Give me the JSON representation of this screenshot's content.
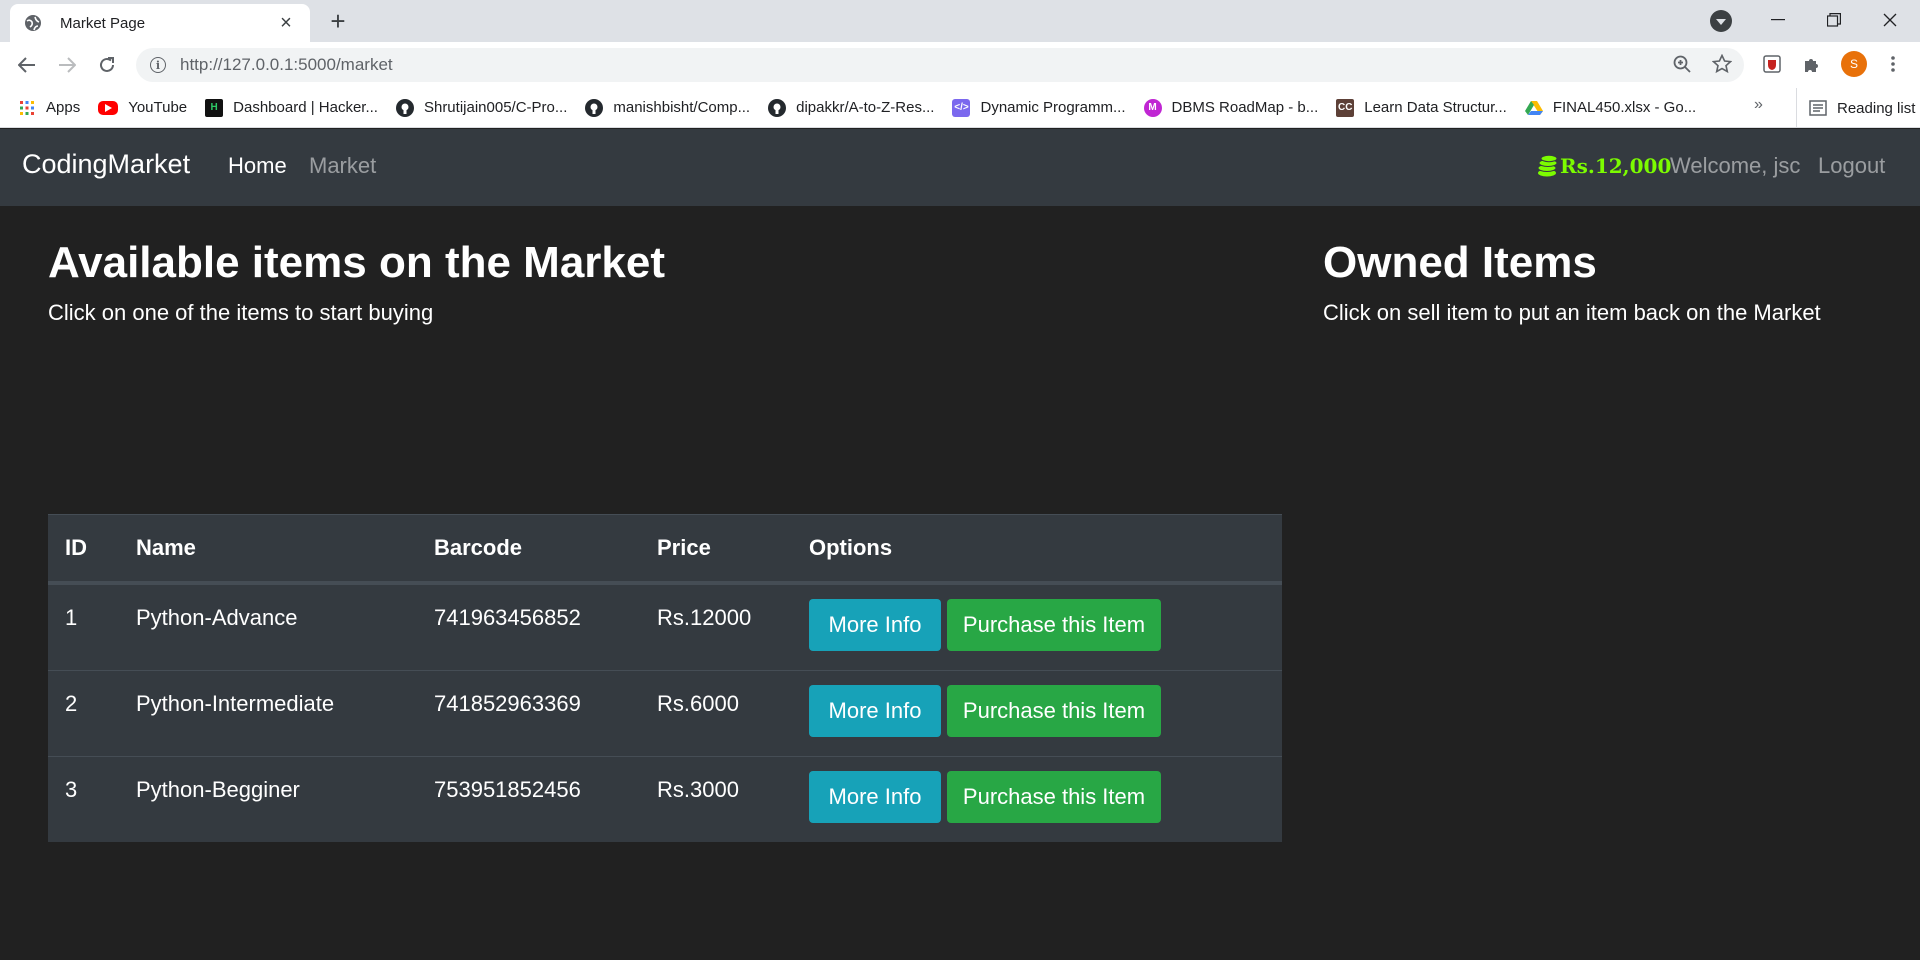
{
  "browser": {
    "tab_title": "Market Page",
    "url": "http://127.0.0.1:5000/market",
    "profile_initial": "S",
    "bookmarks": [
      {
        "label": "Apps",
        "icon": "apps-grid-icon"
      },
      {
        "label": "YouTube",
        "icon": "youtube-icon"
      },
      {
        "label": "Dashboard | Hacker...",
        "icon": "hackerrank-icon"
      },
      {
        "label": "Shrutijain005/C-Pro...",
        "icon": "github-icon"
      },
      {
        "label": "manishbisht/Comp...",
        "icon": "github-icon"
      },
      {
        "label": "dipakkr/A-to-Z-Res...",
        "icon": "github-icon"
      },
      {
        "label": "Dynamic Programm...",
        "icon": "code-icon"
      },
      {
        "label": "DBMS RoadMap - b...",
        "icon": "m-icon"
      },
      {
        "label": "Learn Data Structur...",
        "icon": "cc-icon"
      },
      {
        "label": "FINAL450.xlsx - Go...",
        "icon": "google-drive-icon"
      }
    ],
    "bookmarks_more": "»",
    "reading_list": "Reading list"
  },
  "navbar": {
    "brand": "CodingMarket",
    "home": "Home",
    "market": "Market",
    "balance": "Rs.12,000",
    "welcome": "Welcome, jsc",
    "logout": "Logout",
    "balance_color": "#7cfc00"
  },
  "market": {
    "title": "Available items on the Market",
    "subtitle": "Click on one of the items to start buying",
    "columns": [
      "ID",
      "Name",
      "Barcode",
      "Price",
      "Options"
    ],
    "rows": [
      {
        "id": "1",
        "name": "Python-Advance",
        "barcode": "741963456852",
        "price": "Rs.12000"
      },
      {
        "id": "2",
        "name": "Python-Intermediate",
        "barcode": "741852963369",
        "price": "Rs.6000"
      },
      {
        "id": "3",
        "name": "Python-Begginer",
        "barcode": "753951852456",
        "price": "Rs.3000"
      }
    ],
    "more_info_label": "More Info",
    "purchase_label": "Purchase this Item"
  },
  "owned": {
    "title": "Owned Items",
    "subtitle": "Click on sell item to put an item back on the Market"
  }
}
